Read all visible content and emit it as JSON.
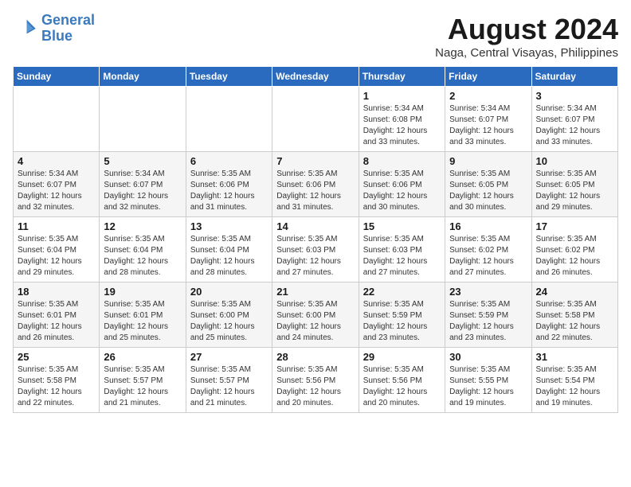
{
  "logo": {
    "line1": "General",
    "line2": "Blue"
  },
  "title": "August 2024",
  "subtitle": "Naga, Central Visayas, Philippines",
  "header_colors": {
    "bg": "#2a6abf"
  },
  "weekdays": [
    "Sunday",
    "Monday",
    "Tuesday",
    "Wednesday",
    "Thursday",
    "Friday",
    "Saturday"
  ],
  "weeks": [
    [
      {
        "day": "",
        "info": ""
      },
      {
        "day": "",
        "info": ""
      },
      {
        "day": "",
        "info": ""
      },
      {
        "day": "",
        "info": ""
      },
      {
        "day": "1",
        "info": "Sunrise: 5:34 AM\nSunset: 6:08 PM\nDaylight: 12 hours\nand 33 minutes."
      },
      {
        "day": "2",
        "info": "Sunrise: 5:34 AM\nSunset: 6:07 PM\nDaylight: 12 hours\nand 33 minutes."
      },
      {
        "day": "3",
        "info": "Sunrise: 5:34 AM\nSunset: 6:07 PM\nDaylight: 12 hours\nand 33 minutes."
      }
    ],
    [
      {
        "day": "4",
        "info": "Sunrise: 5:34 AM\nSunset: 6:07 PM\nDaylight: 12 hours\nand 32 minutes."
      },
      {
        "day": "5",
        "info": "Sunrise: 5:34 AM\nSunset: 6:07 PM\nDaylight: 12 hours\nand 32 minutes."
      },
      {
        "day": "6",
        "info": "Sunrise: 5:35 AM\nSunset: 6:06 PM\nDaylight: 12 hours\nand 31 minutes."
      },
      {
        "day": "7",
        "info": "Sunrise: 5:35 AM\nSunset: 6:06 PM\nDaylight: 12 hours\nand 31 minutes."
      },
      {
        "day": "8",
        "info": "Sunrise: 5:35 AM\nSunset: 6:06 PM\nDaylight: 12 hours\nand 30 minutes."
      },
      {
        "day": "9",
        "info": "Sunrise: 5:35 AM\nSunset: 6:05 PM\nDaylight: 12 hours\nand 30 minutes."
      },
      {
        "day": "10",
        "info": "Sunrise: 5:35 AM\nSunset: 6:05 PM\nDaylight: 12 hours\nand 29 minutes."
      }
    ],
    [
      {
        "day": "11",
        "info": "Sunrise: 5:35 AM\nSunset: 6:04 PM\nDaylight: 12 hours\nand 29 minutes."
      },
      {
        "day": "12",
        "info": "Sunrise: 5:35 AM\nSunset: 6:04 PM\nDaylight: 12 hours\nand 28 minutes."
      },
      {
        "day": "13",
        "info": "Sunrise: 5:35 AM\nSunset: 6:04 PM\nDaylight: 12 hours\nand 28 minutes."
      },
      {
        "day": "14",
        "info": "Sunrise: 5:35 AM\nSunset: 6:03 PM\nDaylight: 12 hours\nand 27 minutes."
      },
      {
        "day": "15",
        "info": "Sunrise: 5:35 AM\nSunset: 6:03 PM\nDaylight: 12 hours\nand 27 minutes."
      },
      {
        "day": "16",
        "info": "Sunrise: 5:35 AM\nSunset: 6:02 PM\nDaylight: 12 hours\nand 27 minutes."
      },
      {
        "day": "17",
        "info": "Sunrise: 5:35 AM\nSunset: 6:02 PM\nDaylight: 12 hours\nand 26 minutes."
      }
    ],
    [
      {
        "day": "18",
        "info": "Sunrise: 5:35 AM\nSunset: 6:01 PM\nDaylight: 12 hours\nand 26 minutes."
      },
      {
        "day": "19",
        "info": "Sunrise: 5:35 AM\nSunset: 6:01 PM\nDaylight: 12 hours\nand 25 minutes."
      },
      {
        "day": "20",
        "info": "Sunrise: 5:35 AM\nSunset: 6:00 PM\nDaylight: 12 hours\nand 25 minutes."
      },
      {
        "day": "21",
        "info": "Sunrise: 5:35 AM\nSunset: 6:00 PM\nDaylight: 12 hours\nand 24 minutes."
      },
      {
        "day": "22",
        "info": "Sunrise: 5:35 AM\nSunset: 5:59 PM\nDaylight: 12 hours\nand 23 minutes."
      },
      {
        "day": "23",
        "info": "Sunrise: 5:35 AM\nSunset: 5:59 PM\nDaylight: 12 hours\nand 23 minutes."
      },
      {
        "day": "24",
        "info": "Sunrise: 5:35 AM\nSunset: 5:58 PM\nDaylight: 12 hours\nand 22 minutes."
      }
    ],
    [
      {
        "day": "25",
        "info": "Sunrise: 5:35 AM\nSunset: 5:58 PM\nDaylight: 12 hours\nand 22 minutes."
      },
      {
        "day": "26",
        "info": "Sunrise: 5:35 AM\nSunset: 5:57 PM\nDaylight: 12 hours\nand 21 minutes."
      },
      {
        "day": "27",
        "info": "Sunrise: 5:35 AM\nSunset: 5:57 PM\nDaylight: 12 hours\nand 21 minutes."
      },
      {
        "day": "28",
        "info": "Sunrise: 5:35 AM\nSunset: 5:56 PM\nDaylight: 12 hours\nand 20 minutes."
      },
      {
        "day": "29",
        "info": "Sunrise: 5:35 AM\nSunset: 5:56 PM\nDaylight: 12 hours\nand 20 minutes."
      },
      {
        "day": "30",
        "info": "Sunrise: 5:35 AM\nSunset: 5:55 PM\nDaylight: 12 hours\nand 19 minutes."
      },
      {
        "day": "31",
        "info": "Sunrise: 5:35 AM\nSunset: 5:54 PM\nDaylight: 12 hours\nand 19 minutes."
      }
    ]
  ]
}
